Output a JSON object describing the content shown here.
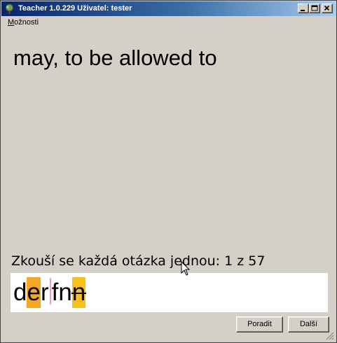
{
  "window": {
    "title": "Teacher 1.0.229 Uživatel: tester"
  },
  "menu": {
    "items": [
      {
        "prefix": "",
        "underlined": "M",
        "rest": "ožnosti"
      }
    ]
  },
  "question": {
    "text": "may, to be allowed to"
  },
  "status": {
    "text": "Zkouší se každá otázka jednou: 1 z 57"
  },
  "answer": {
    "chars": [
      "d",
      "e",
      "r",
      "f",
      "n",
      "n"
    ]
  },
  "buttons": {
    "hint": "Poradit",
    "next": "Další"
  },
  "colors": {
    "wrong_highlight": "#f5a623",
    "missing_highlight": "#f8c01a",
    "caret_mark": "#f2a0a8"
  }
}
